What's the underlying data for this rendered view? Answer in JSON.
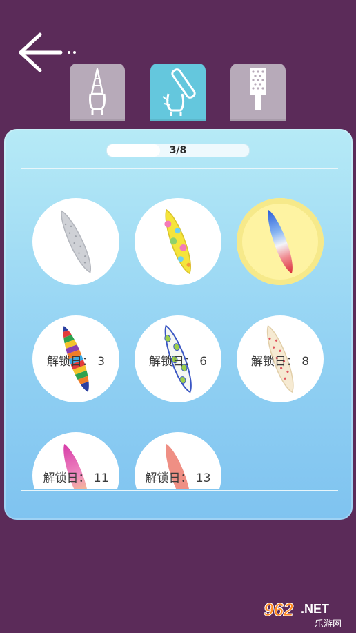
{
  "nav": {
    "back_icon": "back-arrow-icon",
    "tabs": [
      {
        "icon": "nail-shape-icon",
        "active": false
      },
      {
        "icon": "nail-file-icon",
        "active": true
      },
      {
        "icon": "nail-buffer-icon",
        "active": false
      }
    ]
  },
  "progress": {
    "label": "3/8",
    "value": 0.375
  },
  "items": [
    {
      "design": "grey",
      "locked": false,
      "selected": false
    },
    {
      "design": "yellow-floral",
      "locked": false,
      "selected": false
    },
    {
      "design": "blue-white-red",
      "locked": false,
      "selected": true
    },
    {
      "design": "rainbow-stripes",
      "locked": true,
      "label": "解锁日： 3"
    },
    {
      "design": "green-dots",
      "locked": true,
      "label": "解锁日： 6"
    },
    {
      "design": "beige-dots",
      "locked": true,
      "label": "解锁日： 8"
    },
    {
      "design": "pink-yellow",
      "locked": true,
      "label": "解锁日： 11"
    },
    {
      "design": "coral",
      "locked": true,
      "label": "解锁日： 13"
    }
  ],
  "watermark": {
    "brand": "962.NET",
    "sub": "乐游网"
  },
  "colors": {
    "background": "#5b2b59",
    "active_tab": "#64c7dd",
    "inactive_tab": "#b7aab9"
  }
}
